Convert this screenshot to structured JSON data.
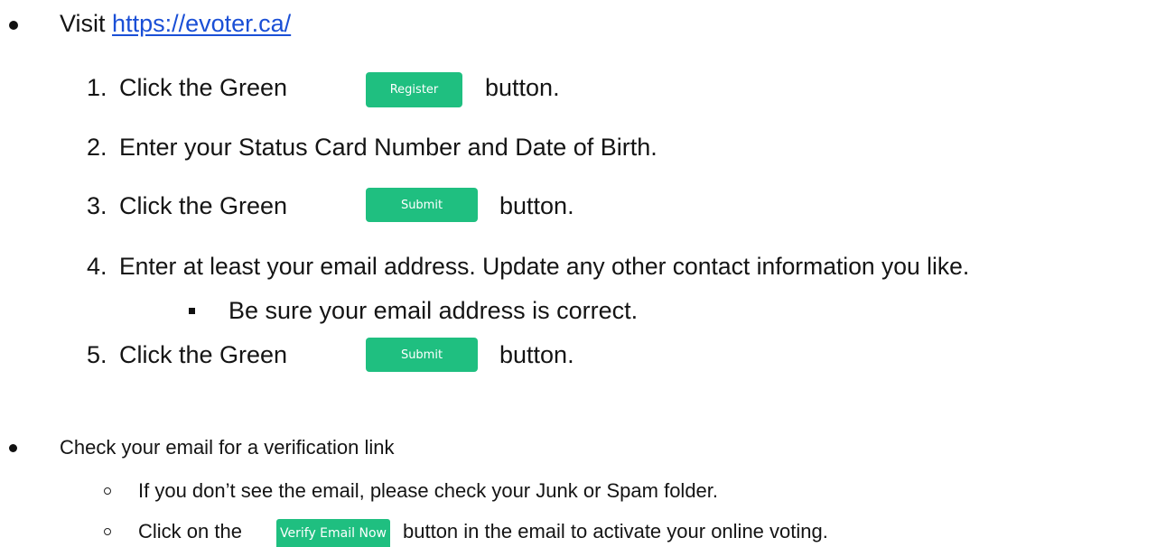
{
  "visit": {
    "label": "Visit",
    "url_text": "https://evoter.ca/"
  },
  "steps": [
    {
      "number": "1.",
      "before": "Click the Green",
      "button": "Register",
      "after": "button."
    },
    {
      "number": "2.",
      "text": "Enter your Status Card Number and Date of Birth."
    },
    {
      "number": "3.",
      "before": "Click the Green",
      "button": "Submit",
      "after": "button."
    },
    {
      "number": "4.",
      "text": "Enter at least your email address. Update any other contact information you like."
    },
    {
      "number": "5.",
      "before": "Click the Green",
      "button": "Submit",
      "after": "button."
    }
  ],
  "step4_sub": "Be sure your email address is correct.",
  "check": {
    "label": "Check your email for a verification link",
    "sub1": "If you don’t see the email, please check your Junk or Spam folder.",
    "sub2_before": "Click on the",
    "sub2_button": "Verify Email Now",
    "sub2_after": "button in the email to activate your online voting."
  },
  "colors": {
    "button_green": "#1fbf80",
    "link_blue": "#1a4fd6"
  },
  "icons": {
    "bullet": "filled-circle",
    "sub_bullet": "filled-square",
    "sub_item": "hollow-circle"
  }
}
